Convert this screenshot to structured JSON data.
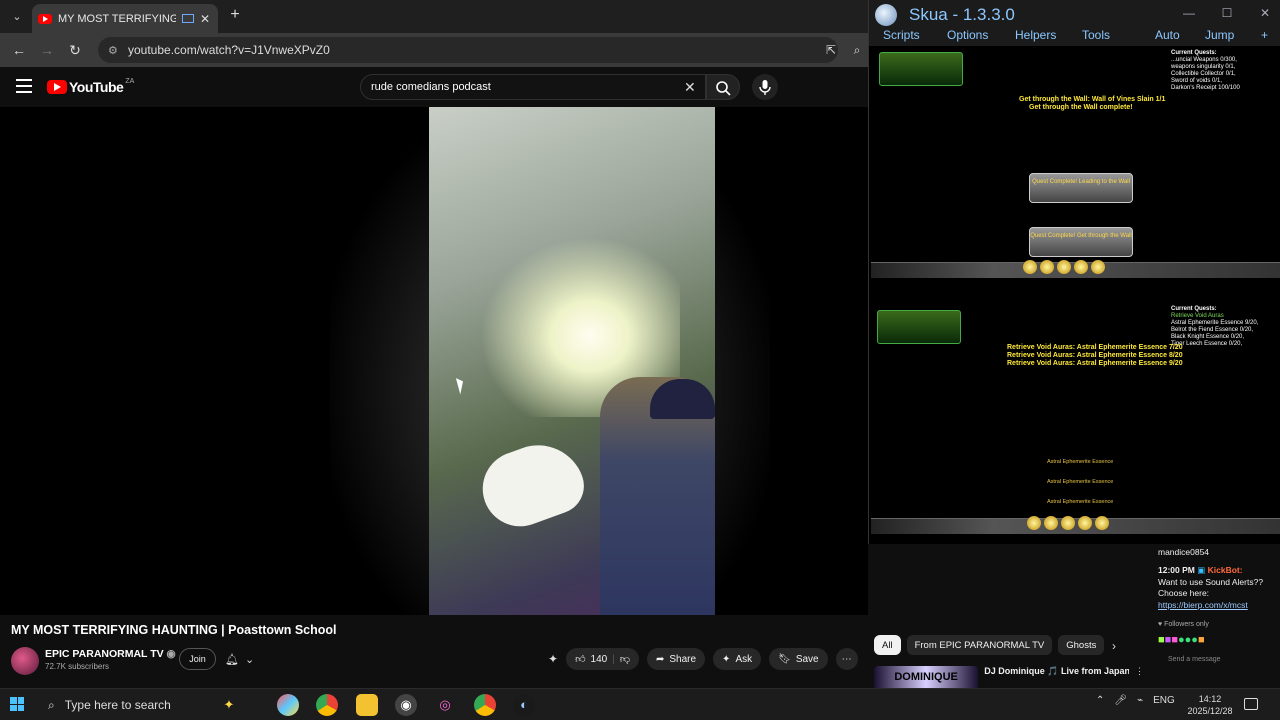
{
  "browser": {
    "tab_title": "MY MOST TERRIFYING HAUNTING | Poasttown School",
    "tab_menu_icon": "chevron-down-icon",
    "url": "youtube.com/watch?v=J1VnweXPvZ0"
  },
  "youtube": {
    "logo_text": "YouTube",
    "country_code": "ZA",
    "search_value": "rude comedians podcast",
    "video_title": "MY MOST TERRIFYING HAUNTING | Poasttown School",
    "channel_name": "EPIC PARANORMAL TV",
    "subscribers": "72.7K subscribers",
    "join_label": "Join",
    "like_count": "140",
    "share_label": "Share",
    "ask_label": "Ask",
    "save_label": "Save",
    "chips": [
      "All",
      "From EPIC PARANORMAL TV",
      "Ghosts"
    ],
    "rec_thumb_text": "DOMINIQUE",
    "rec_title": "DJ Dominique 🎵 Live from Japan | Pure Vibes Sunday"
  },
  "skua": {
    "title": "Skua - 1.3.3.0",
    "menu": [
      "Scripts",
      "Options",
      "Helpers",
      "Tools"
    ],
    "auto_label": "Auto",
    "jump_label": "Jump",
    "game1": {
      "objective_1": "Get through the Wall: Wall of Vines Slain 1/1",
      "objective_2": "Get through the Wall complete!",
      "quests_header": "Current Quests:",
      "quest_lines": [
        "...uncial Weapons 0/300,",
        "weapons singularity 0/1,",
        "Collectible Collector 0/1,",
        "Sword of voids 0/1,",
        "Darkon's Receipt 100/100"
      ],
      "dialog_1": "Quest Complete! Leading to the Wall",
      "dialog_2": "Quest Complete! Get through the Wall"
    },
    "game2": {
      "msg_1": "Retrieve Void Auras: Astral Ephemerite Essence 7/20",
      "msg_2": "Retrieve Void Auras: Astral Ephemerite Essence 8/20",
      "msg_3": "Retrieve Void Auras: Astral Ephemerite Essence 9/20",
      "quests_header": "Current Quests:",
      "quest_lines": [
        "Retrieve Void Auras",
        "Astral Ephemerite Essence 9/20,",
        "Belrot the Fiend Essence 0/20,",
        "Black Knight Essence 0/20,",
        "Tiger Leech Essence 0/20,"
      ],
      "drop": "Astral Ephemerite Essence"
    }
  },
  "chat": {
    "username": "mandice0854",
    "time": "12:00 PM",
    "bot_name": "KickBot:",
    "line_1": "Want to use Sound Alerts??",
    "line_2": "Choose here:",
    "link": "https://bierp.com/x/mcst",
    "followers_only": "Followers only",
    "send_placeholder": "Send a message"
  },
  "taskbar": {
    "search_placeholder": "Type here to search",
    "language": "ENG",
    "time": "14:12",
    "date": "2025/12/28"
  },
  "colors": {
    "youtube_red": "#ff0000",
    "skua_blue": "#8cc8ff",
    "quest_yellow": "#ffe93a"
  }
}
